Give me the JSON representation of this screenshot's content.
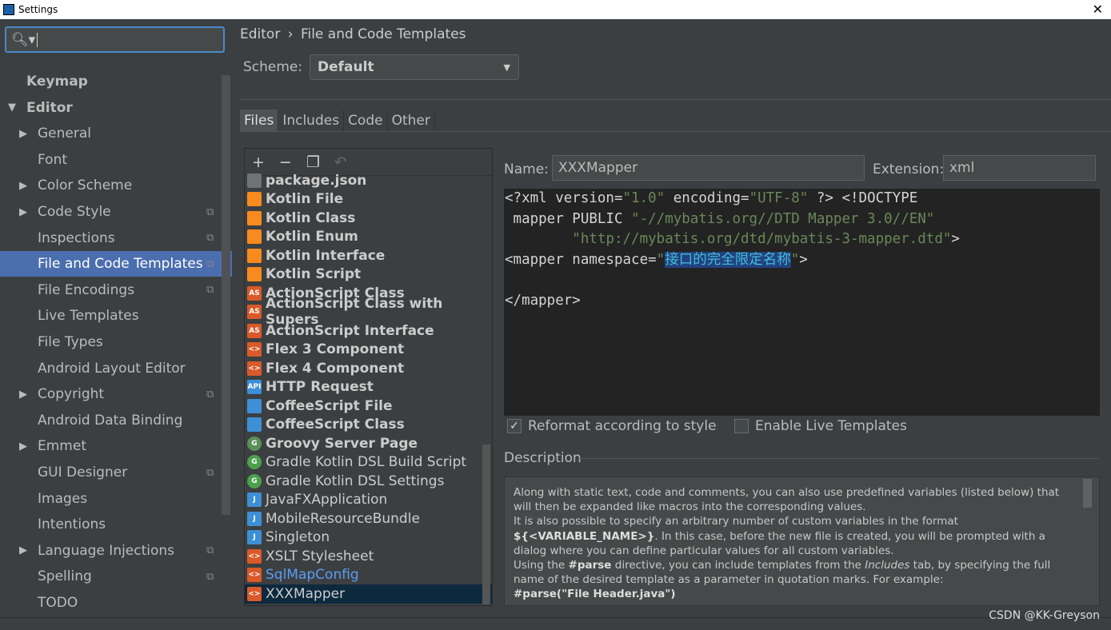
{
  "window": {
    "title": "Settings"
  },
  "search": {
    "value": ""
  },
  "sidebar": {
    "items": [
      {
        "label": "Keymap",
        "indent": 0,
        "bold": true
      },
      {
        "label": "Editor",
        "indent": 0,
        "bold": true,
        "expanded": true
      },
      {
        "label": "General",
        "indent": 1,
        "collapsed": true
      },
      {
        "label": "Font",
        "indent": 1
      },
      {
        "label": "Color Scheme",
        "indent": 1,
        "collapsed": true
      },
      {
        "label": "Code Style",
        "indent": 1,
        "collapsed": true,
        "project": true
      },
      {
        "label": "Inspections",
        "indent": 1,
        "project": true
      },
      {
        "label": "File and Code Templates",
        "indent": 1,
        "project": true,
        "selected": true
      },
      {
        "label": "File Encodings",
        "indent": 1,
        "project": true
      },
      {
        "label": "Live Templates",
        "indent": 1
      },
      {
        "label": "File Types",
        "indent": 1
      },
      {
        "label": "Android Layout Editor",
        "indent": 1
      },
      {
        "label": "Copyright",
        "indent": 1,
        "collapsed": true,
        "project": true
      },
      {
        "label": "Android Data Binding",
        "indent": 1
      },
      {
        "label": "Emmet",
        "indent": 1,
        "collapsed": true
      },
      {
        "label": "GUI Designer",
        "indent": 1,
        "project": true
      },
      {
        "label": "Images",
        "indent": 1
      },
      {
        "label": "Intentions",
        "indent": 1
      },
      {
        "label": "Language Injections",
        "indent": 1,
        "collapsed": true,
        "project": true
      },
      {
        "label": "Spelling",
        "indent": 1,
        "project": true
      },
      {
        "label": "TODO",
        "indent": 1
      }
    ]
  },
  "breadcrumb": {
    "parent": "Editor",
    "sep": "›",
    "current": "File and Code Templates"
  },
  "scheme": {
    "label": "Scheme:",
    "value": "Default"
  },
  "tabs": [
    "Files",
    "Includes",
    "Code",
    "Other"
  ],
  "templates": [
    {
      "label": "package.json",
      "bold": true,
      "icon": "json",
      "color": "#6e7375"
    },
    {
      "label": "Kotlin File",
      "bold": true,
      "icon": "kotlin",
      "color": "#f88a1e"
    },
    {
      "label": "Kotlin Class",
      "bold": true,
      "icon": "kotlin",
      "color": "#f88a1e"
    },
    {
      "label": "Kotlin Enum",
      "bold": true,
      "icon": "kotlin",
      "color": "#f88a1e"
    },
    {
      "label": "Kotlin Interface",
      "bold": true,
      "icon": "kotlin",
      "color": "#f88a1e"
    },
    {
      "label": "Kotlin Script",
      "bold": true,
      "icon": "kotlin",
      "color": "#f88a1e"
    },
    {
      "label": "ActionScript Class",
      "bold": true,
      "icon": "AS",
      "color": "#d9592a"
    },
    {
      "label": "ActionScript Class with Supers",
      "bold": true,
      "icon": "AS",
      "color": "#d9592a"
    },
    {
      "label": "ActionScript Interface",
      "bold": true,
      "icon": "AS",
      "color": "#d9592a"
    },
    {
      "label": "Flex 3 Component",
      "bold": true,
      "icon": "<>",
      "color": "#d9592a"
    },
    {
      "label": "Flex 4 Component",
      "bold": true,
      "icon": "<>",
      "color": "#d9592a"
    },
    {
      "label": "HTTP Request",
      "bold": true,
      "icon": "API",
      "color": "#3d8fd6"
    },
    {
      "label": "CoffeeScript File",
      "bold": true,
      "icon": "coffee",
      "color": "#3d8fd6"
    },
    {
      "label": "CoffeeScript Class",
      "bold": true,
      "icon": "coffee",
      "color": "#3d8fd6"
    },
    {
      "label": "Groovy Server Page",
      "bold": true,
      "icon": "G",
      "color": "#5a8f5a"
    },
    {
      "label": "Gradle Kotlin DSL Build Script",
      "bold": false,
      "icon": "G",
      "color": "#4ca04c"
    },
    {
      "label": "Gradle Kotlin DSL Settings",
      "bold": false,
      "icon": "G",
      "color": "#4ca04c"
    },
    {
      "label": "JavaFXApplication",
      "bold": false,
      "icon": "J",
      "color": "#3d8fd6"
    },
    {
      "label": "MobileResourceBundle",
      "bold": false,
      "icon": "J",
      "color": "#3d8fd6"
    },
    {
      "label": "Singleton",
      "bold": false,
      "icon": "J",
      "color": "#3d8fd6"
    },
    {
      "label": "XSLT Stylesheet",
      "bold": false,
      "icon": "<>",
      "color": "#d9592a"
    },
    {
      "label": "SqlMapConfig",
      "bold": false,
      "icon": "<>",
      "color": "#d9592a",
      "link": true
    },
    {
      "label": "XXXMapper",
      "bold": false,
      "icon": "<>",
      "color": "#d9592a",
      "selected": true
    }
  ],
  "editor": {
    "name_label": "Name:",
    "name": "XXXMapper",
    "ext_label": "Extension:",
    "ext": "xml",
    "code": {
      "l1a": "<?xml version=",
      "l1b": "\"1.0\"",
      "l1c": " encoding=",
      "l1d": "\"UTF-8\"",
      "l1e": " ?> <!DOCTYPE",
      "l2a": " mapper PUBLIC ",
      "l2b": "\"-//mybatis.org//DTD Mapper 3.0//EN\"",
      "l3a": "        ",
      "l3b": "\"http://mybatis.org/dtd/mybatis-3-mapper.dtd\"",
      "l3c": ">",
      "l4a": "<mapper namespace=",
      "l4b": "\"",
      "l4c": "接口的完全限定名称",
      "l4d": "\"",
      ">": ">",
      "l6": "</mapper>"
    },
    "reformat": {
      "label": "Reformat according to style",
      "checked": true
    },
    "live": {
      "label": "Enable Live Templates",
      "checked": false
    }
  },
  "description": {
    "label": "Description",
    "p1": "Along with static text, code and comments, you can also use predefined variables (listed below) that will then be expanded like macros into the corresponding values.",
    "p2a": "It is also possible to specify an arbitrary number of custom variables in the format ",
    "p2b": "${<VARIABLE_NAME>}",
    "p2c": ". In this case, before the new file is created, you will be prompted with a dialog where you can define particular values for all custom variables.",
    "p3a": "Using the ",
    "p3b": "#parse",
    "p3c": " directive, you can include templates from the ",
    "p3d": "Includes",
    "p3e": " tab, by specifying the full name of the desired template as a parameter in quotation marks. For example:",
    "p4": "#parse(\"File Header.java\")"
  },
  "watermark": "CSDN @KK-Greyson",
  "colors": {
    "selection": "#4b6eaf",
    "list_selection": "#0d293e",
    "string": "#6a8759",
    "background": "#3c3f41"
  }
}
